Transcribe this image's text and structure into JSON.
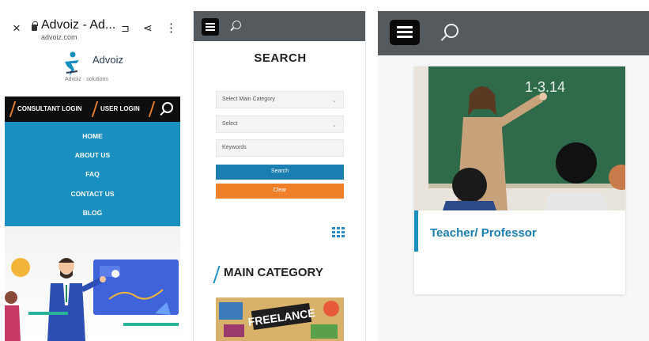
{
  "panel1": {
    "browser": {
      "close": "×",
      "title": "Advoiz - Ad...",
      "url": "advoiz.com"
    },
    "logo": {
      "name": "Advoiz",
      "tagline": "Advoiz · solutions"
    },
    "login": {
      "consultant": "CONSULTANT LOGIN",
      "user": "USER LOGIN"
    },
    "nav": [
      "HOME",
      "ABOUT US",
      "FAQ",
      "CONTACT US",
      "BLOG"
    ]
  },
  "panel2": {
    "heading": "SEARCH",
    "fields": {
      "category": "Select Main Category",
      "select": "Select",
      "keywords": "Keywords"
    },
    "buttons": {
      "search": "Search",
      "clear": "Clear"
    },
    "main_category": "MAIN CATEGORY",
    "image_text": "FREELANCE"
  },
  "panel3": {
    "card_title": "Teacher/ Professor",
    "board_text": "1-3.14"
  },
  "colors": {
    "accent_blue": "#1a8fc2",
    "orange": "#f07f2a",
    "topbar": "#555a5e"
  }
}
